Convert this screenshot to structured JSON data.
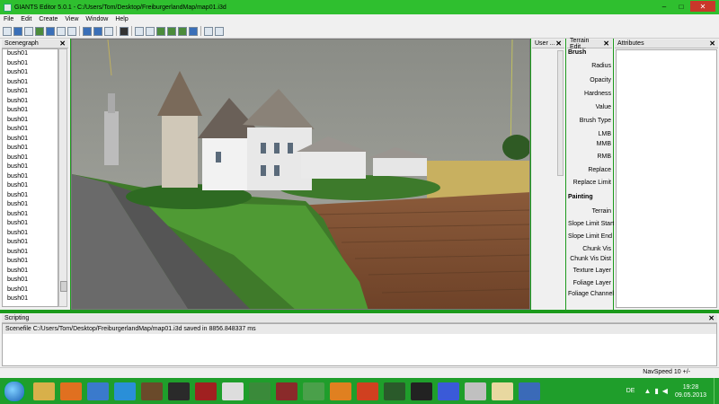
{
  "window": {
    "title": "GIANTS Editor 5.0.1 - C:/Users/Tom/Desktop/FreiburgerlandMap/map01.i3d",
    "minimize": "–",
    "maximize": "□",
    "close": "✕"
  },
  "menu": [
    "File",
    "Edit",
    "Create",
    "View",
    "Window",
    "Help"
  ],
  "panels": {
    "scenegraph_title": "Scenegraph",
    "user_attr_title": "User ...",
    "terrain_title": "Terrain Edit...",
    "attributes_title": "Attributes",
    "scripting_title": "Scripting",
    "close_glyph": "✕"
  },
  "scenegraph": {
    "items": [
      "bush01",
      "bush01",
      "bush01",
      "bush01",
      "bush01",
      "bush01",
      "bush01",
      "bush01",
      "bush01",
      "bush01",
      "bush01",
      "bush01",
      "bush01",
      "bush01",
      "bush01",
      "bush01",
      "bush01",
      "bush01",
      "bush01",
      "bush01",
      "bush01",
      "bush01",
      "bush01",
      "bush01",
      "bush01",
      "bush01",
      "bush01"
    ]
  },
  "terrain": {
    "brush_label": "Brush",
    "brush_rows": [
      "Radius",
      "Opacity",
      "Hardness",
      "Value",
      "Brush Type",
      "LMB",
      "MMB",
      "RMB",
      "Replace",
      "Replace Limit"
    ],
    "painting_label": "Painting",
    "painting_rows": [
      "Terrain",
      "Slope Limit Start",
      "Slope Limit End",
      "Chunk Vis",
      "Chunk Vis Dist",
      "Texture Layer",
      "Foliage Layer",
      "Foliage Channels"
    ]
  },
  "scripting": {
    "log": "Scenefile C:/Users/Tom/Desktop/FreiburgerlandMap/map01.i3d saved in 8856.848337 ms"
  },
  "status": {
    "navspeed": "NavSpeed 10 +/-"
  },
  "taskbar": {
    "lang": "DE",
    "time": "19:28",
    "date": "09.05.2013"
  }
}
